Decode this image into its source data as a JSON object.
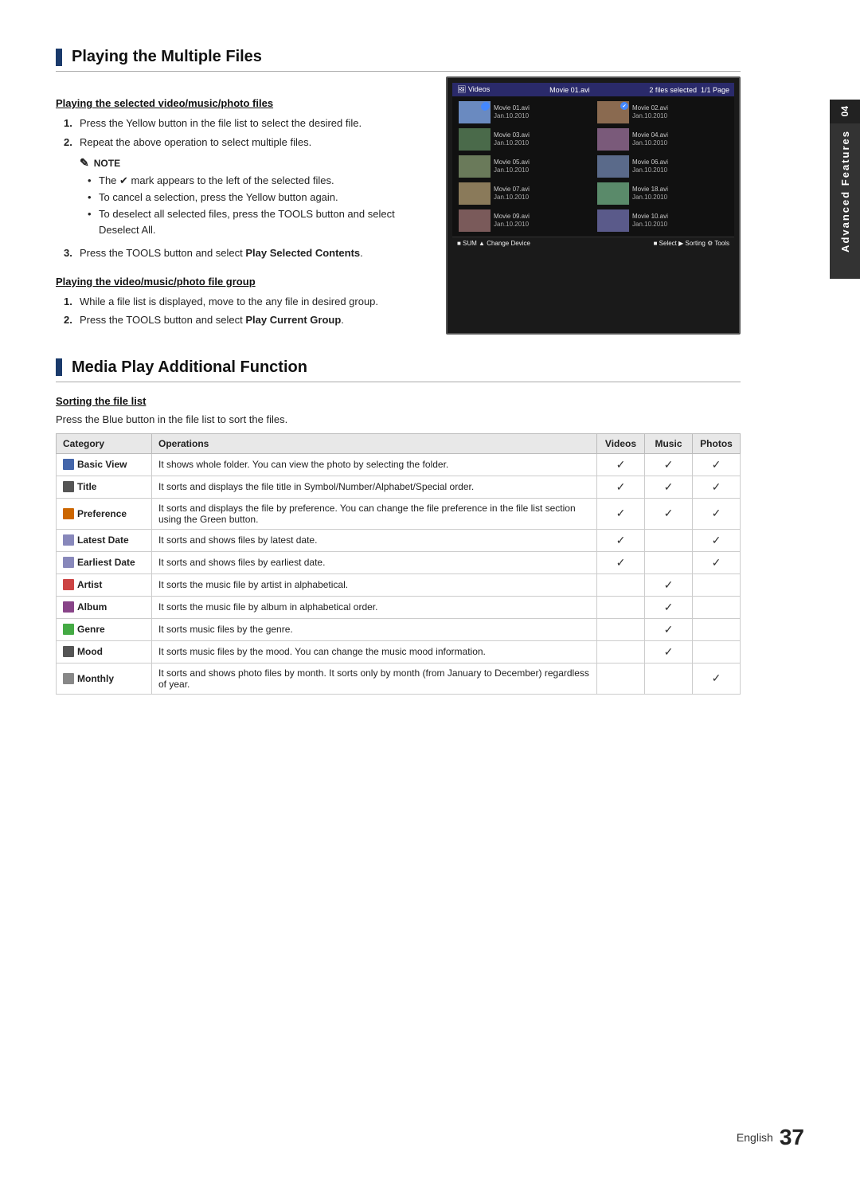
{
  "sidebar": {
    "chapter_number": "04",
    "chapter_title": "Advanced Features"
  },
  "section1": {
    "title": "Playing the Multiple Files",
    "sub1": {
      "heading": "Playing the selected video/music/photo files",
      "steps": [
        "Press the Yellow button in the file list to select the desired file.",
        "Repeat the above operation to select multiple files."
      ],
      "note_label": "NOTE",
      "note_bullets": [
        "The ✔ mark appears to the left of the selected files.",
        "To cancel a selection, press the Yellow button again.",
        "To deselect all selected files, press the TOOLS button and select Deselect All."
      ],
      "step3": "Press the TOOLS button and select Play Selected Contents."
    },
    "sub2": {
      "heading": "Playing the video/music/photo file group",
      "steps": [
        "While a file list is displayed, move to the any file in desired group.",
        "Press the TOOLS button and select Play Current Group."
      ]
    }
  },
  "section2": {
    "title": "Media Play Additional Function",
    "sub1": {
      "heading": "Sorting the file list",
      "intro": "Press the Blue button in the file list to sort the files."
    },
    "table": {
      "headers": [
        "Category",
        "Operations",
        "Videos",
        "Music",
        "Photos"
      ],
      "rows": [
        {
          "icon_type": "blue",
          "category": "Basic View",
          "operation": "It shows whole folder. You can view the photo by selecting the folder.",
          "videos": true,
          "music": true,
          "photos": true
        },
        {
          "icon_type": "dark",
          "category": "Title",
          "operation": "It sorts and displays the file title in Symbol/Number/Alphabet/Special order.",
          "videos": true,
          "music": true,
          "photos": true
        },
        {
          "icon_type": "orange",
          "category": "Preference",
          "operation": "It sorts and displays the file by preference. You can change the file preference in the file list section using the Green button.",
          "videos": true,
          "music": true,
          "photos": true
        },
        {
          "icon_type": "cal",
          "category": "Latest Date",
          "operation": "It sorts and shows files by latest date.",
          "videos": true,
          "music": false,
          "photos": true
        },
        {
          "icon_type": "cal",
          "category": "Earliest Date",
          "operation": "It sorts and shows files by earliest date.",
          "videos": true,
          "music": false,
          "photos": true
        },
        {
          "icon_type": "music",
          "category": "Artist",
          "operation": "It sorts the music file by artist in alphabetical.",
          "videos": false,
          "music": true,
          "photos": false
        },
        {
          "icon_type": "purple",
          "category": "Album",
          "operation": "It sorts the music file by album in alphabetical order.",
          "videos": false,
          "music": true,
          "photos": false
        },
        {
          "icon_type": "green",
          "category": "Genre",
          "operation": "It sorts music files by the genre.",
          "videos": false,
          "music": true,
          "photos": false
        },
        {
          "icon_type": "dark",
          "category": "Mood",
          "operation": "It sorts music files by the mood. You can change the music mood information.",
          "videos": false,
          "music": true,
          "photos": false
        },
        {
          "icon_type": "gray",
          "category": "Monthly",
          "operation": "It sorts and shows photo files by month. It sorts only by month (from January to December) regardless of year.",
          "videos": false,
          "music": false,
          "photos": true
        }
      ]
    }
  },
  "footer": {
    "language": "English",
    "page_number": "37"
  },
  "screenshot": {
    "header_left": "Videos",
    "header_title": "Movie 01.avi",
    "header_right": "2 files selected  1/1 Page",
    "items": [
      {
        "name": "Movie 01.avi",
        "date": "Jan.10.2010",
        "selected": true
      },
      {
        "name": "Movie 02.avi",
        "date": "Jan.10.2010",
        "selected": true
      },
      {
        "name": "Movie 03.avi",
        "date": "Jan.10.2010",
        "selected": false
      },
      {
        "name": "Movie 04.avi",
        "date": "Jan.10.2010",
        "selected": false
      },
      {
        "name": "Movie 05.avi",
        "date": "Jan.10.2010",
        "selected": false
      },
      {
        "name": "Movie 06.avi",
        "date": "Jan.10.2010",
        "selected": false
      },
      {
        "name": "Movie 07.avi",
        "date": "Jan.10.2010",
        "selected": false
      },
      {
        "name": "Movie 18.avi",
        "date": "Jan.10.2010",
        "selected": false
      },
      {
        "name": "Movie 09.avi",
        "date": "Jan.10.2010",
        "selected": false
      },
      {
        "name": "Movie 10.avi",
        "date": "Jan.10.2010",
        "selected": false
      }
    ],
    "footer_items": [
      "■ SUM",
      "▲ Change Device",
      "■ Select",
      "▶ Sorting",
      "⚙ Tools"
    ]
  }
}
